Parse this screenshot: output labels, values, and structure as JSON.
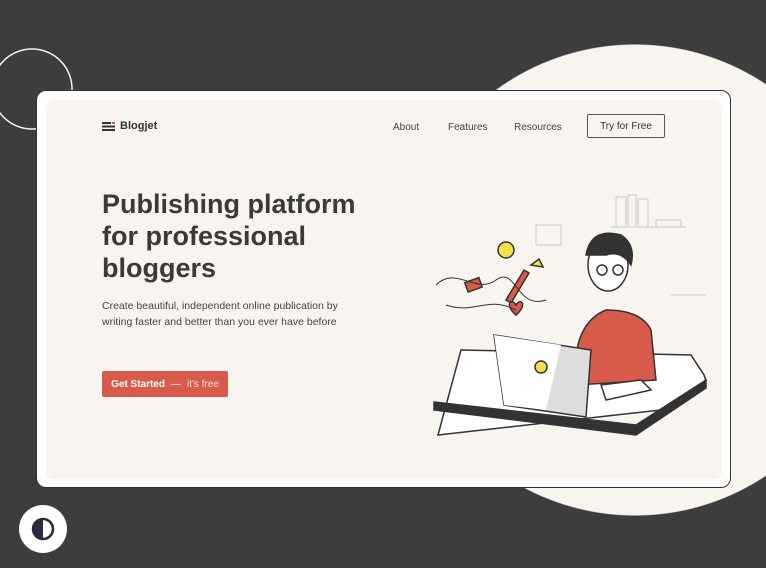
{
  "brand": {
    "name": "Blogjet",
    "icon": "menu-lines-icon"
  },
  "nav": {
    "items": [
      "About",
      "Features",
      "Resources"
    ],
    "cta": "Try for Free"
  },
  "hero": {
    "title": "Publishing platform for professional bloggers",
    "subtitle": "Create beautiful, independent online publication by writing faster and better than you ever have before",
    "cta_main": "Get Started",
    "cta_dash": "—",
    "cta_note": "it's free"
  },
  "colors": {
    "accent": "#d75a4a",
    "bg": "#3d3d3d",
    "cream": "#f8f4f0"
  },
  "theme_toggle": {
    "icon": "contrast-icon"
  }
}
